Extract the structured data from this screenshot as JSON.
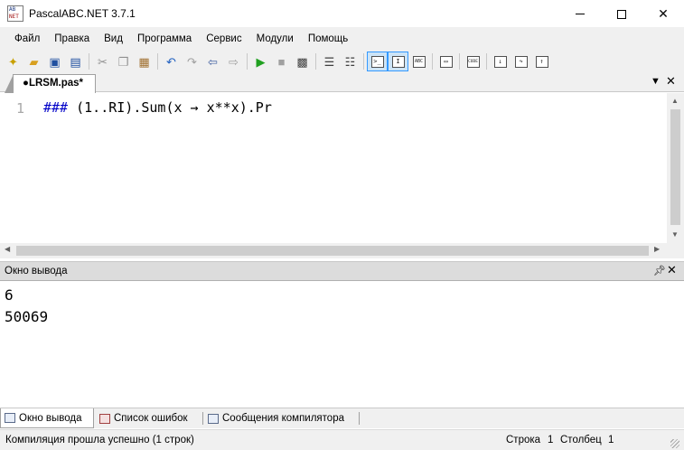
{
  "window": {
    "title": "PascalABC.NET 3.7.1",
    "icon_text_top": "AB",
    "icon_text_bottom": "NET"
  },
  "menu": [
    "Файл",
    "Правка",
    "Вид",
    "Программа",
    "Сервис",
    "Модули",
    "Помощь"
  ],
  "toolbar": {
    "icons": [
      "new-file-icon",
      "open-folder-icon",
      "save-icon",
      "save-all-icon",
      "cut-icon",
      "copy-icon",
      "paste-icon",
      "undo-icon",
      "redo-icon",
      "navigate-back-icon",
      "navigate-forward-icon",
      "run-icon",
      "stop-icon",
      "compile-icon",
      "comment-icon",
      "uncomment-icon",
      "output-window-icon",
      "immediate-window-icon",
      "format-code-icon",
      "form-designer-icon",
      "code-view-icon",
      "step-into-icon",
      "step-over-icon",
      "step-out-icon"
    ],
    "abc_label": "ABC",
    "code_label": "CODE"
  },
  "tab": {
    "label": "●LRSM.pas*"
  },
  "editor": {
    "line_number": "1",
    "code_keyword": "###",
    "code_rest": " (1..RI).Sum(x → x**x).Pr"
  },
  "output": {
    "title": "Окно вывода",
    "lines": [
      "6",
      "50069"
    ]
  },
  "bottom_tabs": {
    "output": "Окно вывода",
    "errors": "Список ошибок",
    "compiler": "Сообщения компилятора"
  },
  "status": {
    "message": "Компиляция прошла успешно (1 строк)",
    "row_label": "Строка",
    "row_value": "1",
    "col_label": "Столбец",
    "col_value": "1"
  },
  "colors": {
    "keyword": "#0000c8",
    "line_number": "#a8a8a8",
    "panel_header": "#dcdcdc",
    "chrome": "#f0f0f0"
  }
}
